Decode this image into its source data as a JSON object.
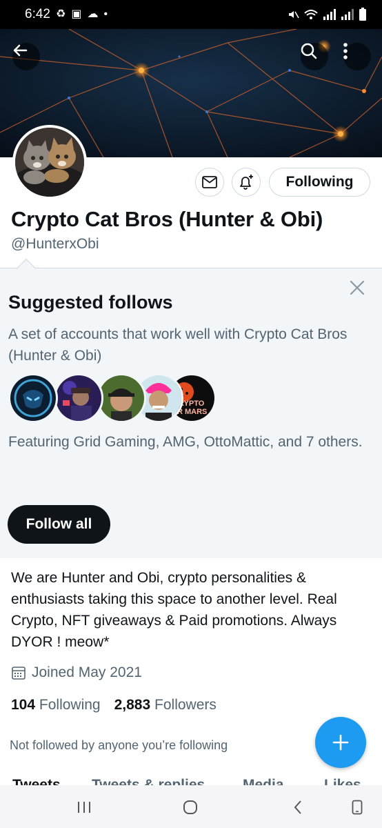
{
  "status_bar": {
    "time": "6:42",
    "dot": "•"
  },
  "profile": {
    "display_name": "Crypto Cat Bros (Hunter & Obi)",
    "handle": "@HunterxObi",
    "following_button": "Following",
    "bio": "We are Hunter and Obi, crypto personalities & enthusiasts taking this space to another level. Real Crypto, NFT giveaways & Paid promotions. Always DYOR ! meow*",
    "joined": "Joined May 2021",
    "following_count": "104",
    "following_label": "Following",
    "followers_count": "2,883",
    "followers_label": "Followers",
    "not_followed_note": "Not followed by anyone you’re following"
  },
  "suggested": {
    "title": "Suggested follows",
    "description": "A set of accounts that work well with Crypto Cat Bros (Hunter & Obi)",
    "featuring": "Featuring Grid Gaming, AMG, OttoMattic, and 7 others.",
    "follow_all": "Follow all",
    "face5_text_line1": "RYPTO",
    "face5_text_line2": "R MARS"
  },
  "tabs": [
    "Tweets",
    "Tweets & replies",
    "Media",
    "Likes"
  ],
  "colors": {
    "accent": "#1d9bf0",
    "text": "#0f1419",
    "muted": "#536471",
    "panel": "#f3f6f8",
    "dark_button": "#0f1419"
  },
  "icons": [
    "back-arrow-icon",
    "search-icon",
    "more-vertical-icon",
    "mail-icon",
    "notification-bell-plus-icon",
    "close-icon",
    "calendar-icon",
    "compose-plus-icon"
  ]
}
